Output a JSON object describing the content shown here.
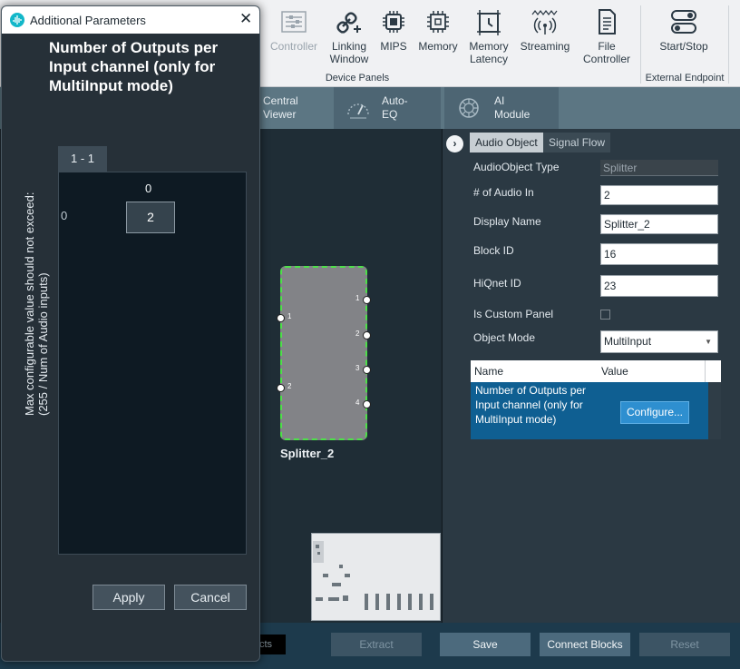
{
  "ribbon": {
    "buttons": [
      {
        "label": "Controller",
        "icon": "controller-sliders-icon",
        "enabled": false
      },
      {
        "label": "Linking\nWindow",
        "icon": "link-plus-icon",
        "enabled": true
      },
      {
        "label": "MIPS",
        "icon": "chip-icon",
        "enabled": true
      },
      {
        "label": "Memory",
        "icon": "memory-chip-icon",
        "enabled": true
      },
      {
        "label": "Memory\nLatency",
        "icon": "latency-frame-icon",
        "enabled": true
      },
      {
        "label": "Streaming",
        "icon": "antenna-icon",
        "enabled": true
      },
      {
        "label": "File\nController",
        "icon": "document-icon",
        "enabled": true
      },
      {
        "label": "Start/Stop",
        "icon": "toggle-icon",
        "enabled": true
      }
    ],
    "groups": [
      "Device Panels",
      "External Endpoint"
    ]
  },
  "toolbar2": {
    "items": [
      {
        "label": "Central\nViewer",
        "icon": ""
      },
      {
        "label": "Auto-\nEQ",
        "icon": "gauge-icon"
      },
      {
        "label": "AI\nModule",
        "icon": "ai-brain-icon"
      }
    ]
  },
  "canvas": {
    "block_name": "Splitter_2",
    "inputs": [
      "1",
      "2"
    ],
    "outputs": [
      "1",
      "2",
      "3",
      "4"
    ]
  },
  "properties": {
    "tabs": [
      "Audio Object",
      "Signal Flow"
    ],
    "active_tab": "Audio Object",
    "fields": {
      "audio_object_type_label": "AudioObject Type",
      "audio_object_type": "Splitter",
      "num_audio_in_label": "# of Audio In",
      "num_audio_in": "2",
      "display_name_label": "Display Name",
      "display_name": "Splitter_2",
      "block_id_label": "Block ID",
      "block_id": "16",
      "hiqnet_id_label": "HiQnet ID",
      "hiqnet_id": "23",
      "is_custom_panel_label": "Is Custom Panel",
      "is_custom_panel": false,
      "object_mode_label": "Object Mode",
      "object_mode": "MultiInput"
    },
    "grid": {
      "headers": [
        "Name",
        "Value"
      ],
      "rows": [
        {
          "name": "Number of Outputs per Input channel (only for MultiInput mode)",
          "value_button": "Configure..."
        }
      ]
    }
  },
  "bottom_bar": {
    "cut_input_text": "cts",
    "buttons": [
      {
        "label": "Extract",
        "enabled": false
      },
      {
        "label": "Save",
        "enabled": true
      },
      {
        "label": "Connect Blocks",
        "enabled": true
      },
      {
        "label": "Reset",
        "enabled": false
      }
    ]
  },
  "dialog": {
    "title": "Additional Parameters",
    "heading": "Number of Outputs per Input channel (only for MultiInput mode)",
    "vertical_note_line1": "Max configurable value should not exceed:",
    "vertical_note_line2": "(255 / Num of Audio inputs)",
    "matrix_tab": "1 - 1",
    "column_header": "0",
    "row_header": "0",
    "cell_value": "2",
    "apply_label": "Apply",
    "cancel_label": "Cancel"
  },
  "colors": {
    "ribbon_bg": "#f0f1f3",
    "accent_blue": "#2e8fd0",
    "selected_row": "#0f5f92",
    "block_border": "#4ee04a",
    "dialog_bg": "#263038"
  }
}
